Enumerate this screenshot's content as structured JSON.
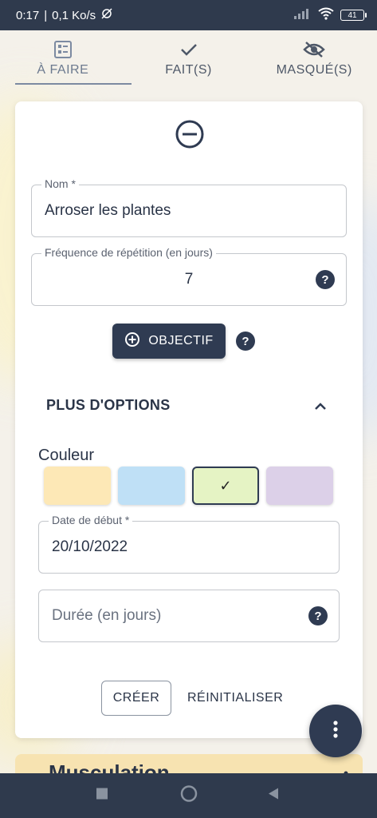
{
  "status_bar": {
    "time": "0:17",
    "network_speed": "0,1 Ko/s",
    "battery": "41"
  },
  "tabs": [
    {
      "label": "À FAIRE",
      "icon": "checklist-icon",
      "active": true
    },
    {
      "label": "FAIT(S)",
      "icon": "check-icon",
      "active": false
    },
    {
      "label": "MASQUÉ(S)",
      "icon": "eye-off-icon",
      "active": false
    }
  ],
  "form": {
    "name": {
      "label": "Nom *",
      "value": "Arroser les plantes"
    },
    "frequency": {
      "label": "Fréquence de répétition (en jours)",
      "value": "7"
    },
    "objectif_button": "OBJECTIF",
    "more_options": "PLUS D'OPTIONS",
    "color_label": "Couleur",
    "colors": [
      {
        "hex": "#fde8b6",
        "selected": false
      },
      {
        "hex": "#bfe0f6",
        "selected": false
      },
      {
        "hex": "#e5f3c4",
        "selected": true,
        "mark": "✓"
      },
      {
        "hex": "#dcd0e8",
        "selected": false
      }
    ],
    "start_date": {
      "label": "Date de début *",
      "value": "20/10/2022"
    },
    "duration": {
      "placeholder": "Durée (en jours)"
    },
    "create_button": "CRÉER",
    "reset_button": "RÉINITIALISER"
  },
  "next_card": {
    "title": "Musculation"
  },
  "accent_color": "#2f3b52"
}
